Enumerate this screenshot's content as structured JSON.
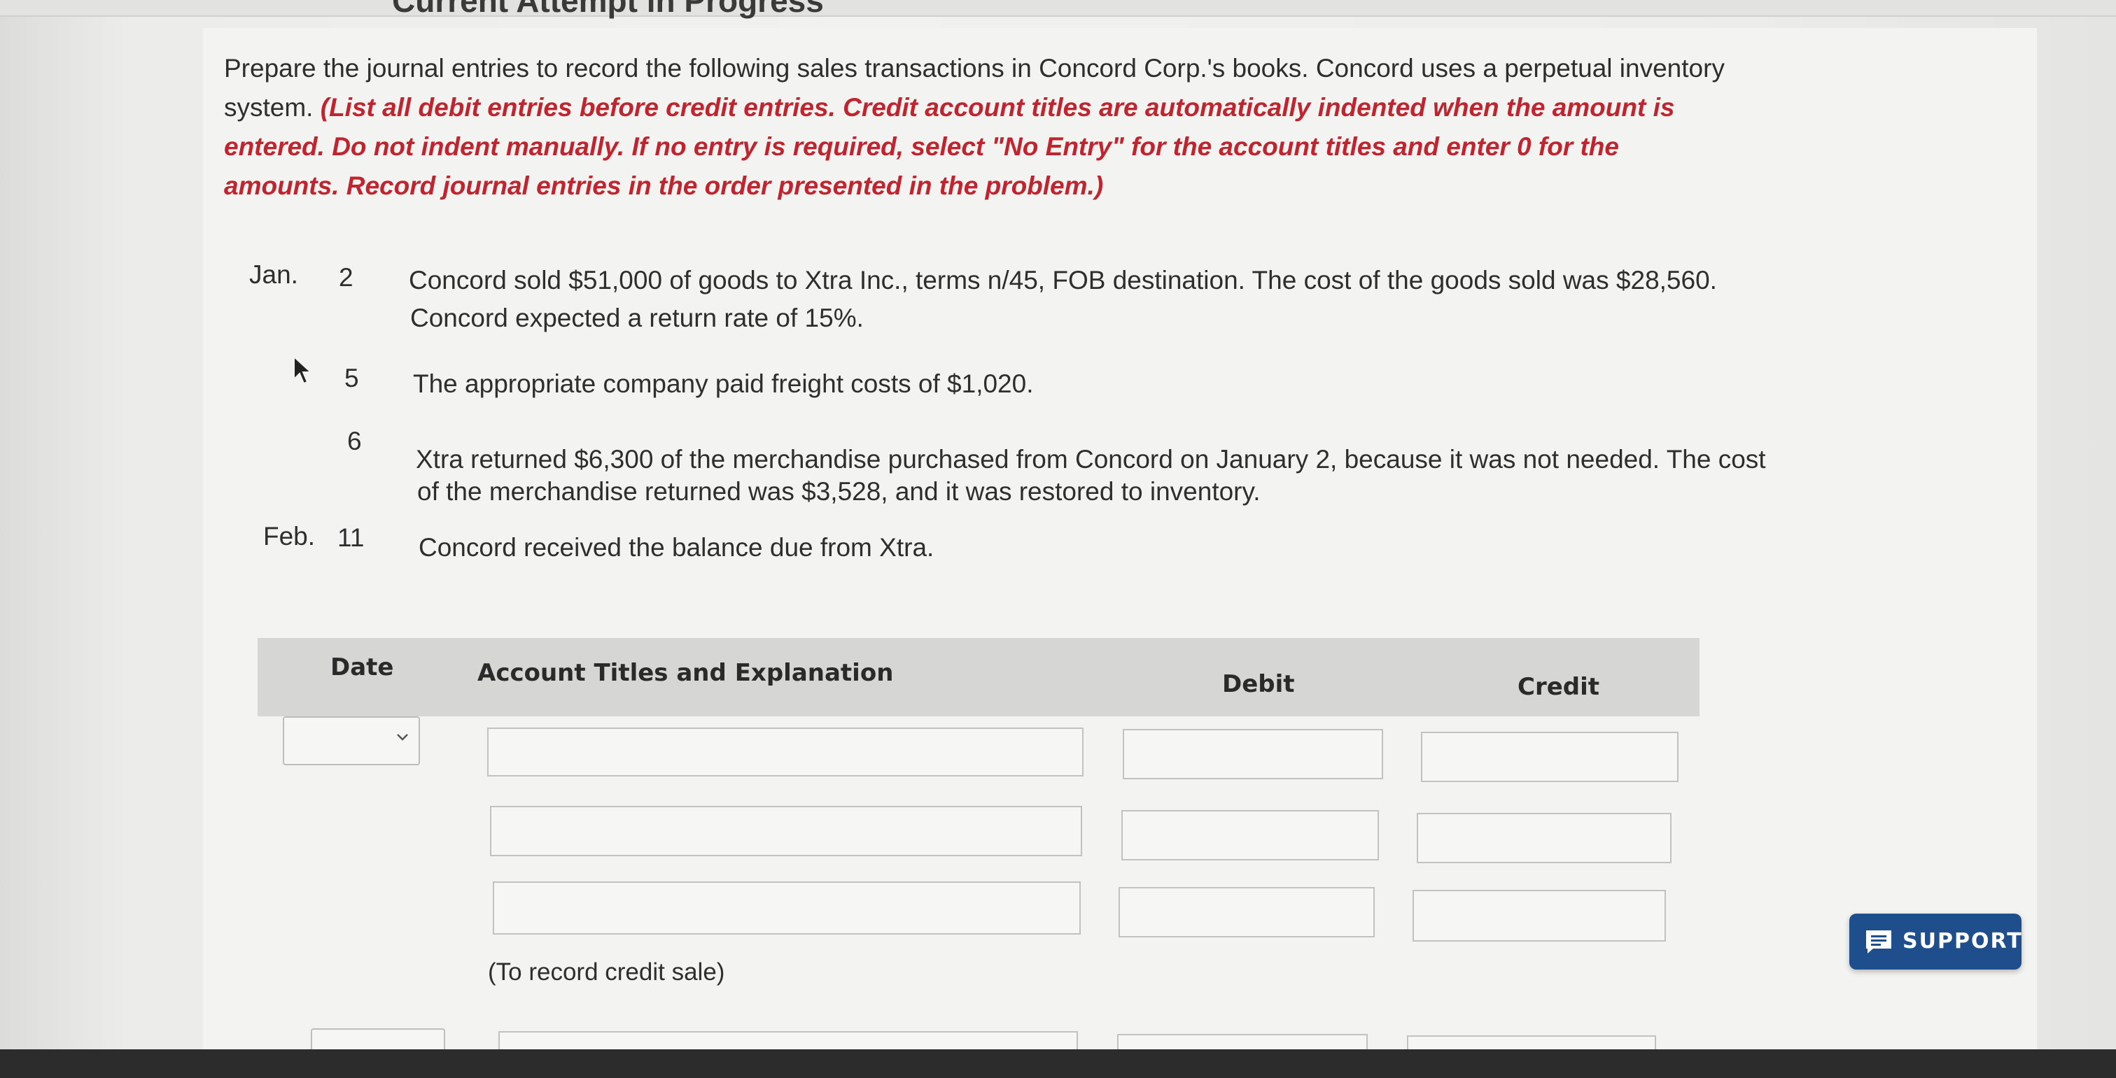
{
  "header": {
    "title": "Current Attempt in Progress"
  },
  "instructions": {
    "intro": "Prepare the journal entries to record the following sales transactions in Concord Corp.'s books. Concord uses a perpetual inventory system.",
    "note": "(List all debit entries before credit entries. Credit account titles are automatically indented when the amount is entered. Do not indent manually. If no entry is required, select \"No Entry\" for the account titles and enter 0 for the amounts. Record journal entries in the order presented in the problem.)"
  },
  "transactions": [
    {
      "month": "Jan.",
      "day": "2",
      "text_line1": "Concord sold $51,000 of goods to Xtra Inc., terms n/45, FOB destination. The cost of the goods sold was $28,560.",
      "text_line2": "Concord expected a return rate of 15%."
    },
    {
      "month": "",
      "day": "5",
      "text_line1": "The appropriate company paid freight costs of $1,020.",
      "text_line2": ""
    },
    {
      "month": "",
      "day": "6",
      "text_line1": "Xtra returned $6,300 of the merchandise purchased from Concord on January 2, because it was not needed. The cost",
      "text_line2": "of the merchandise returned was $3,528, and it was restored to inventory."
    },
    {
      "month": "Feb.",
      "day": "11",
      "text_line1": "Concord received the balance due from Xtra.",
      "text_line2": ""
    }
  ],
  "table": {
    "headers": {
      "date": "Date",
      "account": "Account Titles and Explanation",
      "debit": "Debit",
      "credit": "Credit"
    },
    "entry1_explanation": "(To record credit sale)"
  },
  "support": {
    "label": "SUPPORT",
    "color": "#1f4e8c"
  },
  "colors": {
    "instruction_red": "#c0242f"
  }
}
